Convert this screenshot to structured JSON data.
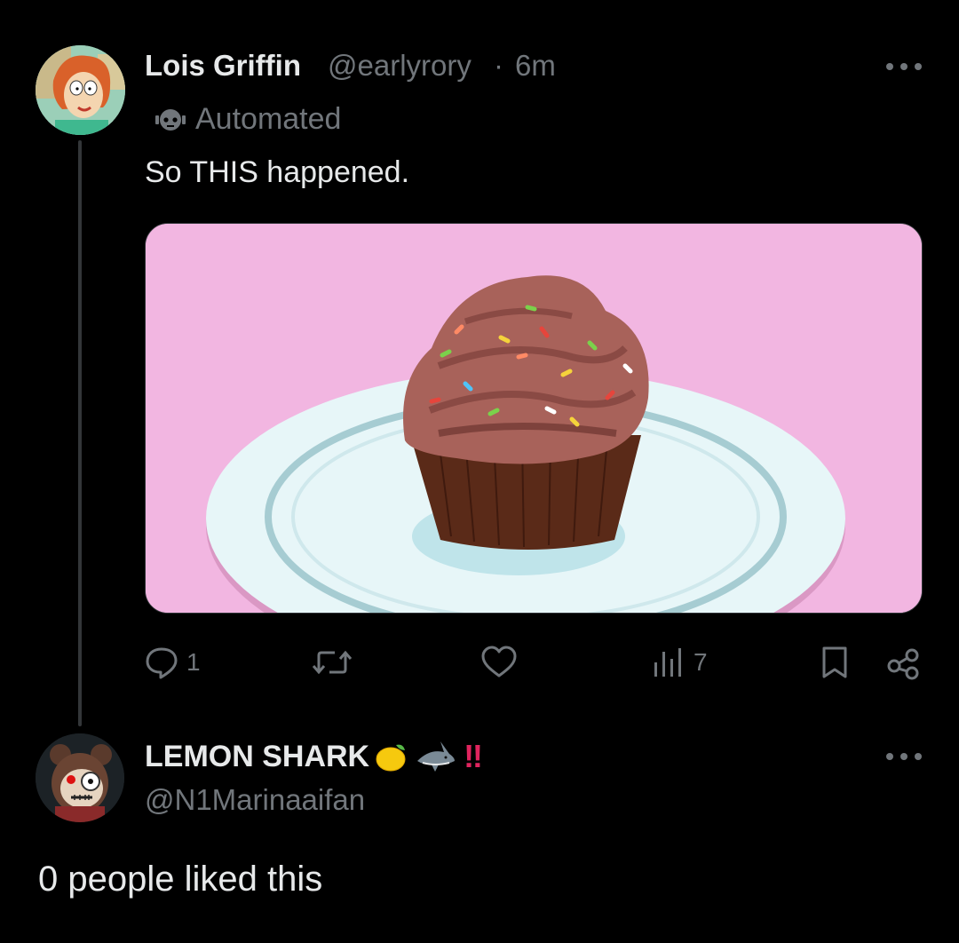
{
  "tweet": {
    "author_name": "Lois Griffin",
    "author_handle": "@earlyrory",
    "separator": "·",
    "time": "6m",
    "automated_label": "Automated",
    "text": "So THIS happened.",
    "media_icon": "cupcake-image",
    "stats": {
      "replies": "1",
      "views": "7"
    }
  },
  "reply": {
    "author_name": "LEMON SHARK",
    "author_handle": "@N1Marinaaifan",
    "name_emoji": [
      "lemon-emoji",
      "shark-emoji",
      "double-exclamation-emoji"
    ],
    "bang_text": "‼"
  },
  "footer": {
    "text": "0 people liked this"
  },
  "colors": {
    "background": "#000000",
    "primary_text": "#e7e9ea",
    "secondary_text": "#71767b",
    "thread_line": "#333639",
    "accent_red": "#e0245e"
  }
}
